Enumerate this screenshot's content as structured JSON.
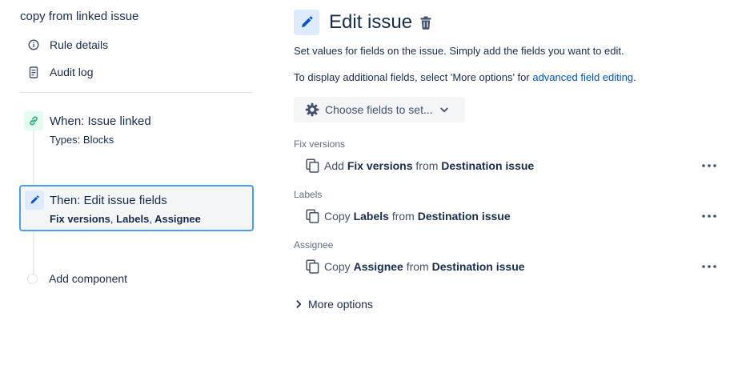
{
  "sidebar": {
    "rule_title": "copy from linked issue",
    "items": [
      {
        "label": "Rule details",
        "icon": "info-icon"
      },
      {
        "label": "Audit log",
        "icon": "document-icon"
      }
    ],
    "trigger": {
      "title": "When: Issue linked",
      "subtitle": "Types: Blocks",
      "icon": "link-icon",
      "color": "#36b37e"
    },
    "action": {
      "title": "Then: Edit issue fields",
      "fields": [
        "Fix versions",
        "Labels",
        "Assignee"
      ],
      "separator": ",",
      "icon": "pencil-icon",
      "color": "#0052cc"
    },
    "add_component": "Add component"
  },
  "editor": {
    "title": "Edit issue",
    "icon": "pencil-icon",
    "delete_icon": "trash-icon",
    "description_1": "Set values for fields on the issue. Simply add the fields you want to edit.",
    "description_2_prefix": "To display additional fields, select 'More options' for ",
    "description_2_link": "advanced field editing",
    "description_2_suffix": ".",
    "choose_fields_label": "Choose fields to set...",
    "fields": [
      {
        "label": "Fix versions",
        "verb": "Add",
        "field": "Fix versions",
        "from": "from",
        "source": "Destination issue"
      },
      {
        "label": "Labels",
        "verb": "Copy",
        "field": "Labels",
        "from": "from",
        "source": "Destination issue"
      },
      {
        "label": "Assignee",
        "verb": "Copy",
        "field": "Assignee",
        "from": "from",
        "source": "Destination issue"
      }
    ],
    "more_options": "More options"
  },
  "colors": {
    "accent": "#0052cc",
    "selected_border": "#4c9aff",
    "text": "#172b4d",
    "muted": "#5e6c84"
  }
}
